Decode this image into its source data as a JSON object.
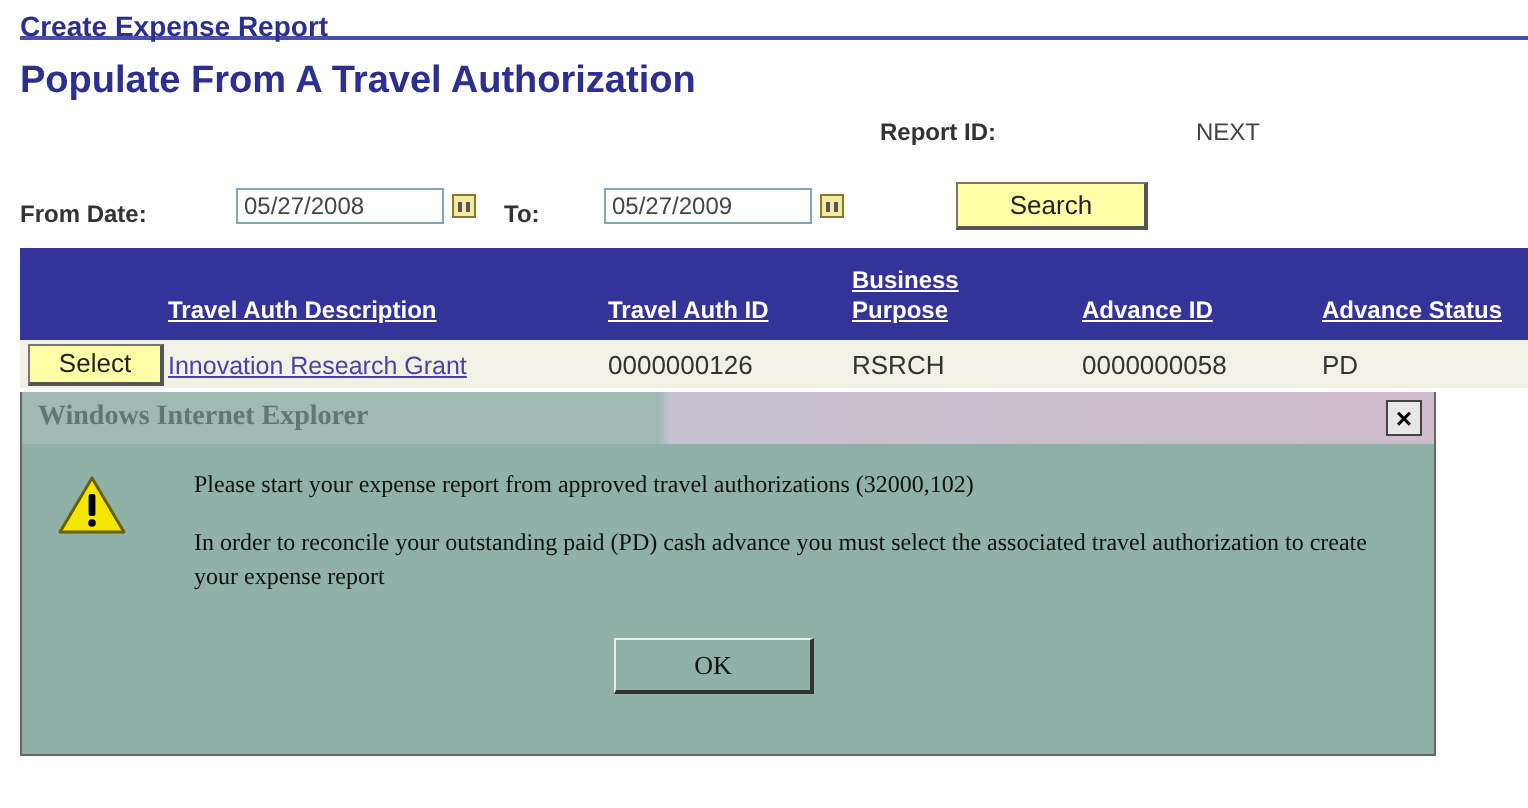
{
  "breadcrumb": "Create Expense Report",
  "title": "Populate From A Travel Authorization",
  "report_id": {
    "label": "Report ID:",
    "value": "NEXT"
  },
  "search": {
    "from_label": "From Date:",
    "from_value": "05/27/2008",
    "to_label": "To:",
    "to_value": "05/27/2009",
    "button": "Search"
  },
  "table": {
    "columns": [
      "Travel Auth Description",
      "Travel Auth ID",
      "Business Purpose",
      "Advance ID",
      "Advance Status"
    ],
    "rows": [
      {
        "button": "Select",
        "description": "Innovation Research Grant",
        "auth_id": "0000000126",
        "purpose": "RSRCH",
        "advance_id": "0000000058",
        "status": "PD"
      }
    ]
  },
  "dialog": {
    "title": "Windows Internet Explorer",
    "close": "×",
    "messages": [
      "Please start your expense report from approved travel authorizations (32000,102)",
      "In order to reconcile your outstanding paid (PD) cash advance you must select the associated travel authorization to create your expense report"
    ],
    "button": "OK"
  }
}
